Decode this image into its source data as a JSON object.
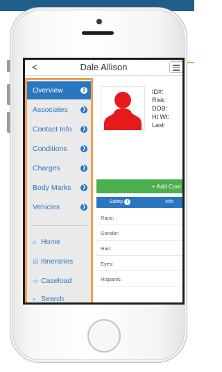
{
  "header": {
    "back_icon": "<",
    "title": "Dale Allison",
    "menu_icon": "hamburger-icon"
  },
  "sidebar": {
    "items": [
      {
        "label": "Overview",
        "active": true
      },
      {
        "label": "Associates"
      },
      {
        "label": "Contact Info"
      },
      {
        "label": "Conditions"
      },
      {
        "label": "Charges"
      },
      {
        "label": "Body Marks"
      },
      {
        "label": "Vehicles"
      }
    ],
    "links": [
      {
        "icon": "home-icon",
        "glyph": "⌂",
        "label": "Home"
      },
      {
        "icon": "checkbox-icon",
        "glyph": "☑",
        "label": "Itineraries"
      },
      {
        "icon": "star-icon",
        "glyph": "☆",
        "label": "Caseload"
      },
      {
        "icon": "search-icon",
        "glyph": "⌕",
        "label": "Search"
      }
    ]
  },
  "profile": {
    "fields": [
      "ID#:",
      "Risk:",
      "DOB:",
      "Ht Wt:",
      "Last:"
    ]
  },
  "actions": {
    "add_contact": "+ Add Cont"
  },
  "tabs": {
    "safety_label": "Safety",
    "safety_badge": "!",
    "info_label": "Info"
  },
  "attributes": [
    "Race:",
    "Gender:",
    "Hair:",
    "Eyes:",
    "Hispanic:"
  ],
  "colors": {
    "accent_blue": "#2a76bf",
    "highlight_orange": "#f0a04a",
    "avatar_red": "#e41a1c",
    "add_green": "#4cae4c"
  }
}
